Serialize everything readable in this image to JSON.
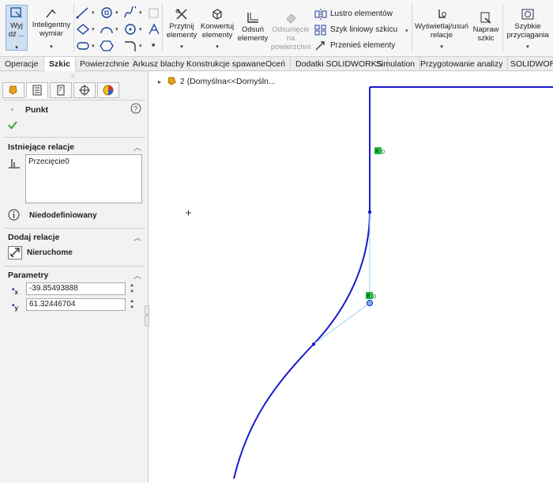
{
  "ribbon": {
    "exit_sketch": "Wyj dź ...",
    "smart_dimension_1": "Inteligentny",
    "smart_dimension_2": "wymiar",
    "trim_1": "Przytnij",
    "trim_2": "elementy",
    "convert_1": "Konwertuj",
    "convert_2": "elementy",
    "offset_1": "Odsuń",
    "offset_2": "elementy",
    "offset_surface_1": "Odsunięcie",
    "offset_surface_2": "na",
    "offset_surface_3": "powierzchni",
    "mirror": "Lustro elementów",
    "linear_pattern": "Szyk liniowy szkicu",
    "move": "Przenieś elementy",
    "show_relations_1": "Wyświetlaj/usuń",
    "show_relations_2": "relacje",
    "repair_1": "Napraw",
    "repair_2": "szkic",
    "quick_snaps_1": "Szybkie",
    "quick_snaps_2": "przyciągania"
  },
  "tabs": [
    "Operacje",
    "Szkic",
    "Powierzchnie",
    "Arkusz blachy",
    "Konstrukcje spawane",
    "Oceń",
    "Dodatki SOLIDWORKS",
    "Simulation",
    "Przygotowanie analizy",
    "SOLIDWORKS"
  ],
  "pm": {
    "title": "Punkt",
    "existing_relations": "Istniejące relacje",
    "relation_item": "Przecięcie0",
    "status": "Niedodefiniowany",
    "add_relations": "Dodaj relacje",
    "fix": "Nieruchome",
    "parameters": "Parametry",
    "x_value": "-39.85493888",
    "y_value": "61.32446704"
  },
  "tree": {
    "label": "2  (Domyślna<<Domyśln..."
  },
  "colors": {
    "sketch_blue": "#1a1acc",
    "construction": "#9ad0ee",
    "relation_green": "#22bb44"
  }
}
